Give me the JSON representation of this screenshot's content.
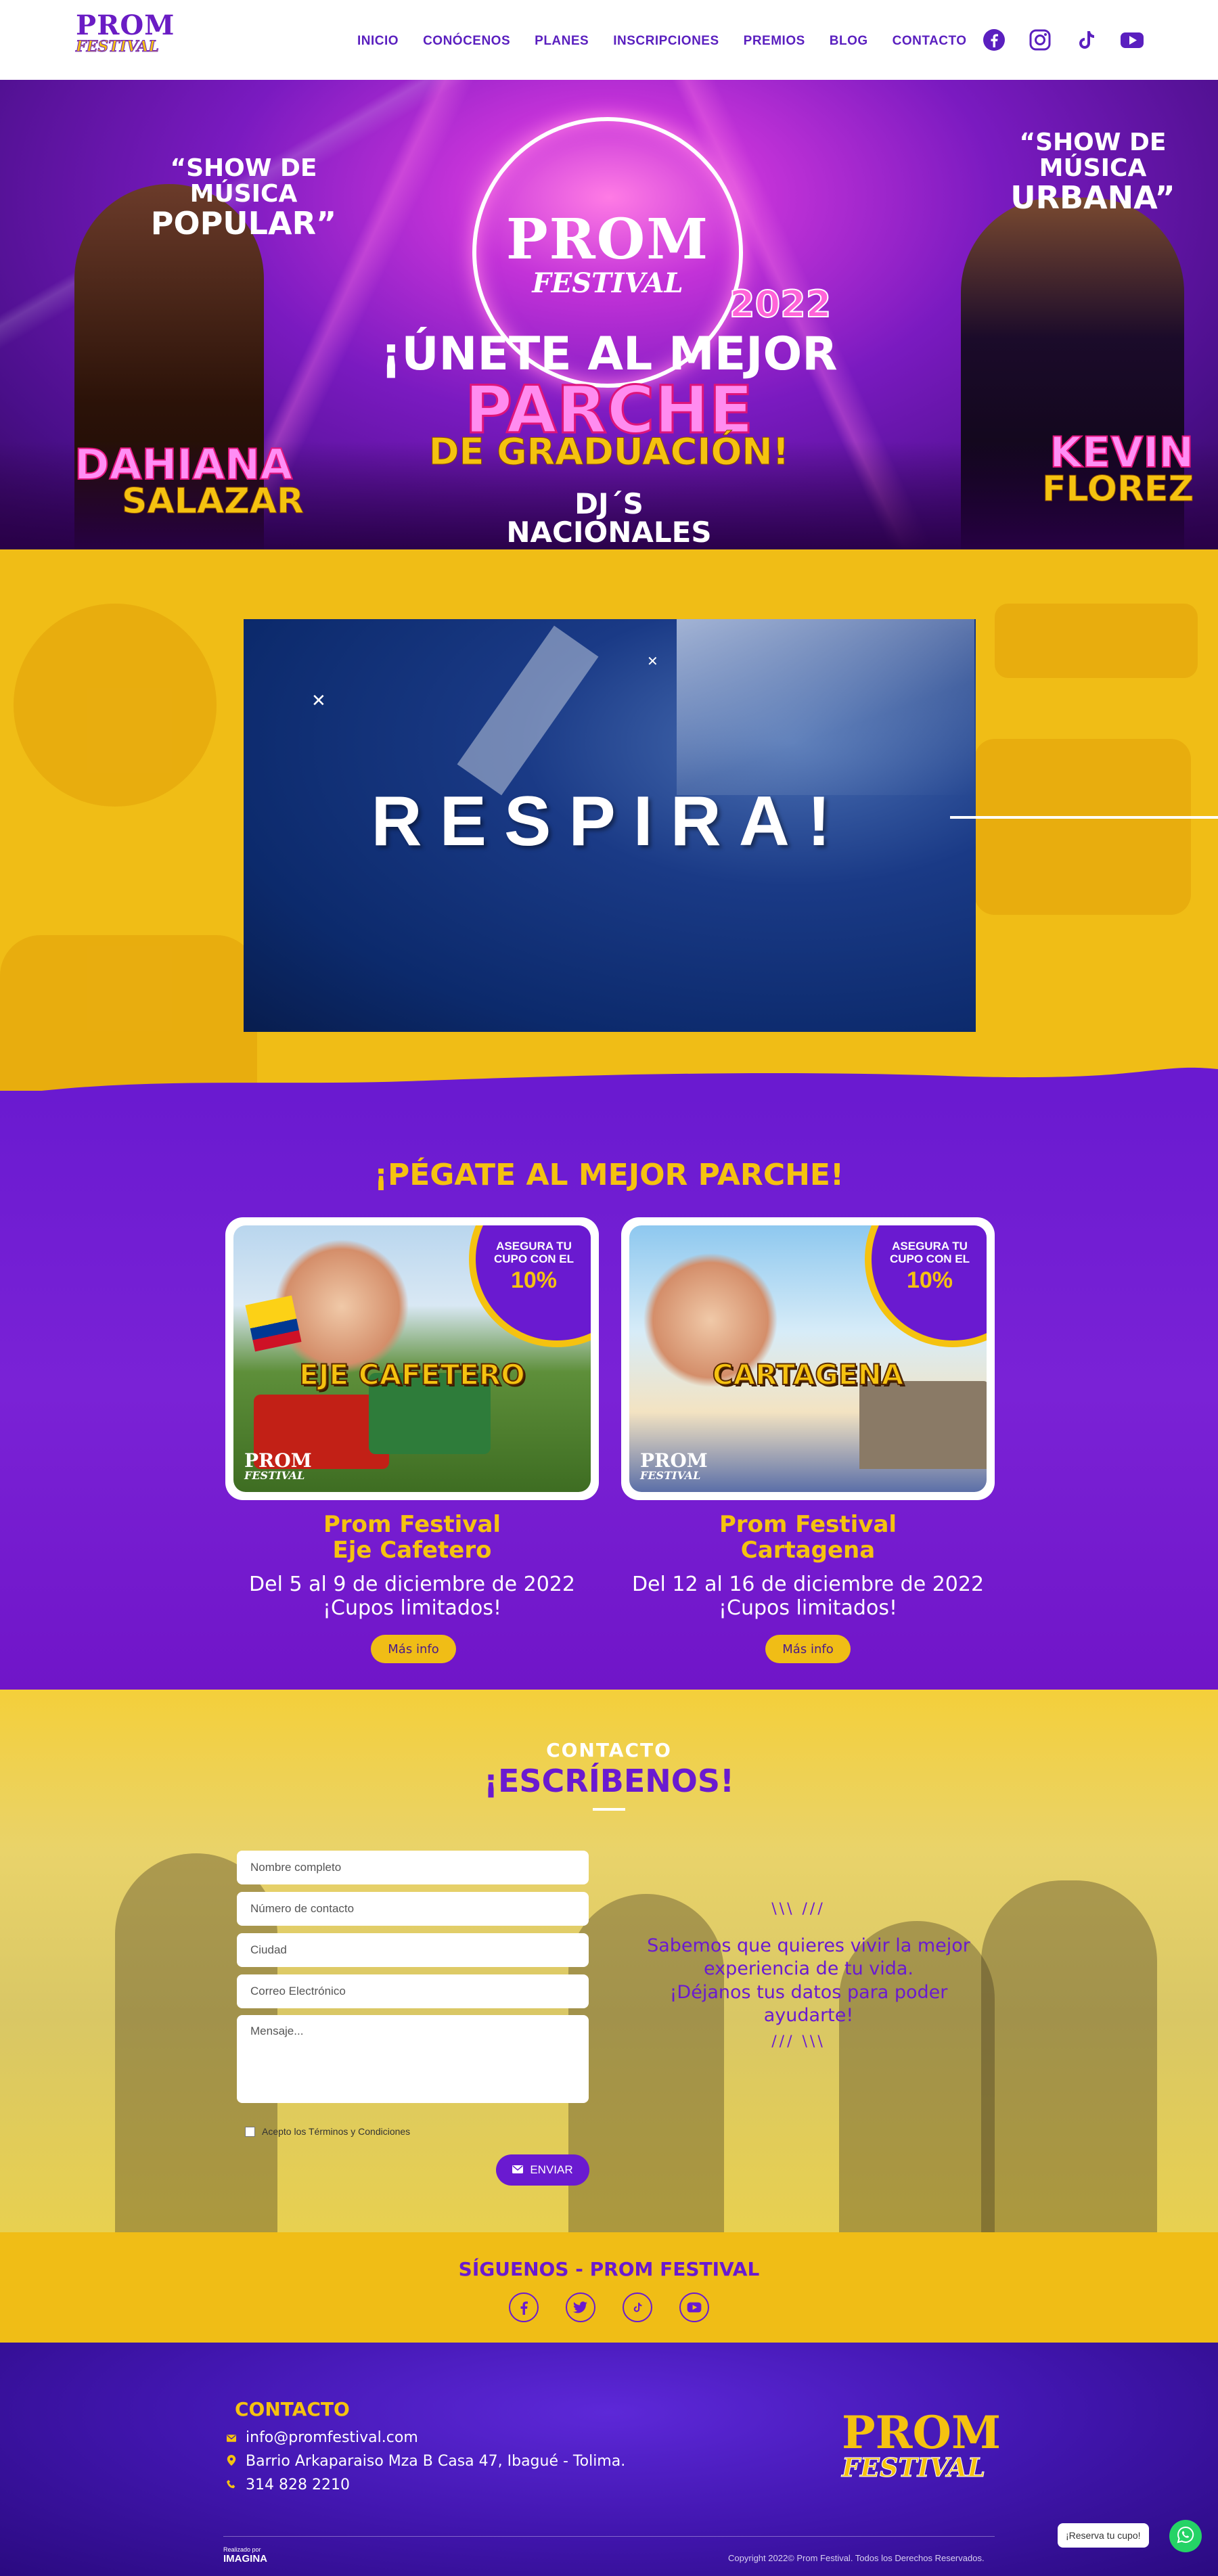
{
  "header": {
    "logo_line1": "PROM",
    "logo_line2": "FESTIVAL",
    "nav": [
      "INICIO",
      "CONÓCENOS",
      "PLANES",
      "INSCRIPCIONES",
      "PREMIOS",
      "BLOG",
      "CONTACTO"
    ],
    "socials": [
      "facebook-icon",
      "instagram-icon",
      "tiktok-icon",
      "youtube-icon"
    ]
  },
  "hero": {
    "left_quote_1": "“SHOW DE MÚSICA",
    "left_quote_2": "POPULAR”",
    "left_first": "DAHIANA",
    "left_last": "SALAZAR",
    "right_quote_1": "“SHOW DE MÚSICA",
    "right_quote_2": "URBANA”",
    "right_first": "KEVIN",
    "right_last": "FLOREZ",
    "logo_line1": "PROM",
    "logo_line2": "FESTIVAL",
    "year": "2022",
    "tag1": "¡ÚNETE AL MEJOR",
    "tag2": "PARCHE",
    "tag3": "DE GRADUACIÓN!",
    "tag4": "DJ´S NACIONALES"
  },
  "video": {
    "title": "RESPIRA!",
    "close_icon": "close-icon"
  },
  "plans": {
    "title": "¡PÉGATE AL MEJOR PARCHE!",
    "items": [
      {
        "badge_1": "ASEGURA TU",
        "badge_2": "CUPO CON EL",
        "badge_pct": "10%",
        "dest": "EJE CAFETERO",
        "logo_1": "PROM",
        "logo_2": "FESTIVAL",
        "title_1": "Prom Festival",
        "title_2": "Eje Cafetero",
        "dates": "Del 5 al 9 de diciembre de 2022",
        "note": "¡Cupos limitados!",
        "button": "Más info"
      },
      {
        "badge_1": "ASEGURA TU",
        "badge_2": "CUPO CON EL",
        "badge_pct": "10%",
        "dest": "CARTAGENA",
        "logo_1": "PROM",
        "logo_2": "FESTIVAL",
        "title_1": "Prom Festival",
        "title_2": "Cartagena",
        "dates": "Del 12 al 16 de diciembre de 2022",
        "note": "¡Cupos limitados!",
        "button": "Más info"
      }
    ]
  },
  "contact": {
    "kicker": "CONTACTO",
    "title": "¡ESCRÍBENOS!",
    "fields": {
      "name": "Nombre completo",
      "phone": "Número de contacto",
      "city": "Ciudad",
      "email": "Correo Electrónico",
      "message": "Mensaje..."
    },
    "terms": "Acepto los Términos y Condiciones",
    "send": "ENVIAR",
    "message_1": "Sabemos que quieres vivir la mejor",
    "message_2": "experiencia de tu vida.",
    "message_3": "¡Déjanos tus datos para poder",
    "message_4": "ayudarte!"
  },
  "follow": {
    "title": "SÍGUENOS - PROM FESTIVAL",
    "icons": [
      "facebook-icon",
      "twitter-icon",
      "tiktok-icon",
      "youtube-icon"
    ]
  },
  "footer": {
    "title": "CONTACTO",
    "email": "info@promfestival.com",
    "address": "Barrio Arkaparaiso Mza B Casa 47, Ibagué - Tolima.",
    "phone": "314 828 2210",
    "logo_1": "PROM",
    "logo_2": "FESTIVAL",
    "credit_small": "Realizado por",
    "credit_brand": "IMAGINA",
    "copyright": "Copyright 2022© Prom Festival. Todos los Derechos Reservados."
  },
  "whatsapp": {
    "label": "¡Reserva tu cupo!"
  },
  "colors": {
    "purple": "#6a1ad0",
    "yellow": "#f0bd16",
    "pink": "#ff8cf0"
  }
}
